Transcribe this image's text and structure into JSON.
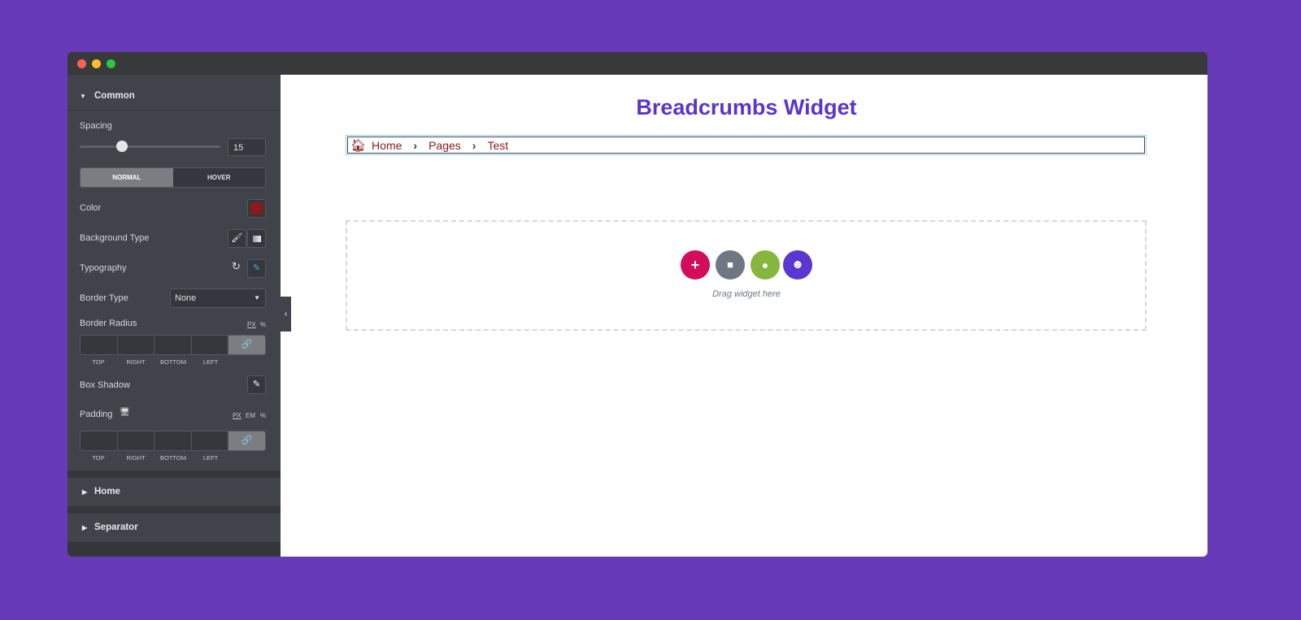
{
  "window": {
    "controls": [
      "close",
      "minimize",
      "maximize"
    ],
    "colors": {
      "close": "#fe5f57",
      "minimize": "#febc2e",
      "maximize": "#28c840"
    }
  },
  "panel": {
    "section_common": "Common",
    "spacing": {
      "label": "Spacing",
      "value": "15",
      "slider_percent": 30
    },
    "state_tabs": {
      "normal": "NORMAL",
      "hover": "HOVER",
      "active": "normal"
    },
    "color": {
      "label": "Color",
      "value": "#8b1a1a"
    },
    "background_type": {
      "label": "Background Type",
      "icons": [
        "brush-icon",
        "gradient-icon"
      ]
    },
    "typography": {
      "label": "Typography"
    },
    "border_type": {
      "label": "Border Type",
      "value": "None"
    },
    "border_radius": {
      "label": "Border Radius",
      "units": [
        "PX",
        "%"
      ],
      "sides": [
        "TOP",
        "RIGHT",
        "BOTTOM",
        "LEFT"
      ]
    },
    "box_shadow": {
      "label": "Box Shadow"
    },
    "padding": {
      "label": "Padding",
      "units": [
        "PX",
        "EM",
        "%"
      ],
      "sides": [
        "TOP",
        "RIGHT",
        "BOTTOM",
        "LEFT"
      ]
    },
    "section_home": "Home",
    "section_separator": "Separator"
  },
  "canvas": {
    "title": "Breadcrumbs Widget",
    "title_color": "#5c33cf",
    "breadcrumb": [
      "Home",
      "Pages",
      "Test"
    ],
    "breadcrumb_color": "#8b1a1a",
    "drop_zone": {
      "hint": "Drag widget here",
      "buttons": [
        "add",
        "template-library",
        "elementor-kit",
        "happy-addons"
      ],
      "colors": [
        "#d30c5c",
        "#6d7882",
        "#86b63e",
        "#5a38cf"
      ]
    }
  }
}
